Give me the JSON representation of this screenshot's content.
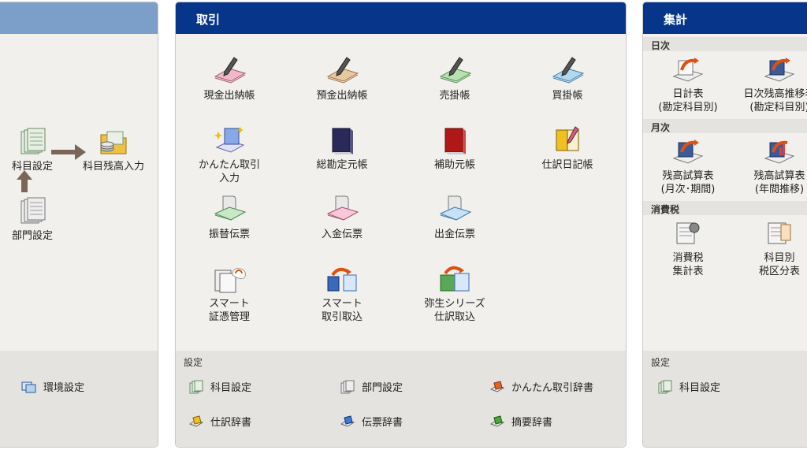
{
  "left_panel": {
    "items": [
      {
        "label": "科目設定"
      },
      {
        "label": "科目残高入力"
      },
      {
        "label": "部門設定"
      }
    ],
    "settings": {
      "items": [
        {
          "label": "環境設定"
        }
      ]
    }
  },
  "torihiki": {
    "title": "取引",
    "items": [
      {
        "label": "現金出納帳"
      },
      {
        "label": "預金出納帳"
      },
      {
        "label": "売掛帳"
      },
      {
        "label": "買掛帳"
      },
      {
        "label": "かんたん取引\n入力"
      },
      {
        "label": "総勘定元帳"
      },
      {
        "label": "補助元帳"
      },
      {
        "label": "仕訳日記帳"
      },
      {
        "label": "振替伝票"
      },
      {
        "label": "入金伝票"
      },
      {
        "label": "出金伝票"
      },
      {
        "label": "スマート\n証憑管理"
      },
      {
        "label": "スマート\n取引取込"
      },
      {
        "label": "弥生シリーズ\n仕訳取込"
      }
    ],
    "settings": {
      "label": "設定",
      "items": [
        {
          "label": "科目設定"
        },
        {
          "label": "部門設定"
        },
        {
          "label": "かんたん取引辞書"
        },
        {
          "label": "仕訳辞書"
        },
        {
          "label": "伝票辞書"
        },
        {
          "label": "摘要辞書"
        }
      ]
    }
  },
  "shukei": {
    "title": "集計",
    "sections": [
      {
        "label": "日次",
        "items": [
          {
            "label": "日計表\n(勘定科目別)"
          },
          {
            "label": "日次残高推移表\n(勘定科目別)"
          }
        ]
      },
      {
        "label": "月次",
        "items": [
          {
            "label": "残高試算表\n(月次･期間)"
          },
          {
            "label": "残高試算表\n(年間推移)"
          }
        ]
      },
      {
        "label": "消費税",
        "items": [
          {
            "label": "消費税\n集計表"
          },
          {
            "label": "科目別\n税区分表"
          }
        ]
      }
    ],
    "settings": {
      "label": "設定",
      "items": [
        {
          "label": "科目設定"
        }
      ]
    }
  },
  "colors": {
    "header_blue": "#06358a",
    "header_light": "#7c9fc9",
    "panel_bg": "#f1f0ed",
    "settings_bg": "#e4e3df",
    "arrow": "#7a6658"
  }
}
